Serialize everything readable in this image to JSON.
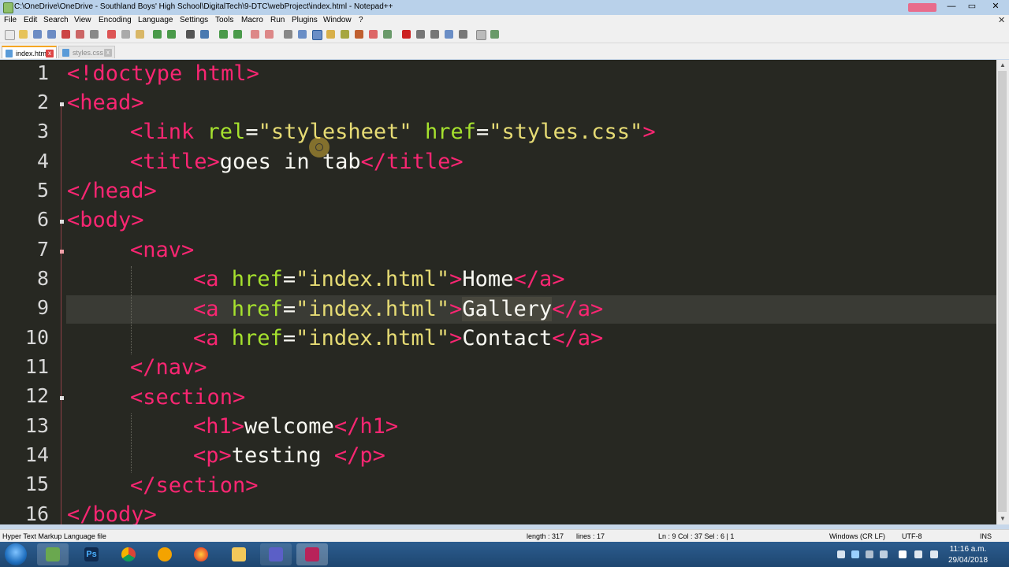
{
  "window": {
    "title": "C:\\OneDrive\\OneDrive - Southland Boys' High School\\DigitalTech\\9-DTC\\webProject\\index.html - Notepad++",
    "minimize": "—",
    "maximize": "▭",
    "close": "✕"
  },
  "menu": [
    "File",
    "Edit",
    "Search",
    "View",
    "Encoding",
    "Language",
    "Settings",
    "Tools",
    "Macro",
    "Run",
    "Plugins",
    "Window",
    "?"
  ],
  "menu_close": "✕",
  "tabs": [
    {
      "label": "index.html",
      "active": true
    },
    {
      "label": "styles.css",
      "active": false
    }
  ],
  "tab_close": "x",
  "line_numbers": [
    "1",
    "2",
    "3",
    "4",
    "5",
    "6",
    "7",
    "8",
    "9",
    "10",
    "11",
    "12",
    "13",
    "14",
    "15",
    "16"
  ],
  "code": {
    "l1_a": "<!doctype html>",
    "l2_a": "<head>",
    "l3_a": "<link ",
    "l3_b": "rel",
    "l3_c": "=",
    "l3_d": "\"stylesheet\"",
    "l3_e": " ",
    "l3_f": "href",
    "l3_g": "=",
    "l3_h": "\"styles.css\"",
    "l3_i": ">",
    "l4_a": "<title>",
    "l4_b": "goes in tab",
    "l4_c": "</title>",
    "l5_a": "</head>",
    "l6_a": "<body>",
    "l7_a": "<nav>",
    "l8_a": "<a ",
    "l8_b": "href",
    "l8_c": "=",
    "l8_d": "\"index.html\"",
    "l8_e": ">",
    "l8_f": "Home",
    "l8_g": "</a>",
    "l9_a": "<a ",
    "l9_b": "href",
    "l9_c": "=",
    "l9_d": "\"index.html\"",
    "l9_e": ">",
    "l9_f": "Gallery",
    "l9_g": "</a>",
    "l10_a": "<a ",
    "l10_b": "href",
    "l10_c": "=",
    "l10_d": "\"index.html\"",
    "l10_e": ">",
    "l10_f": "Contact",
    "l10_g": "</a>",
    "l11_a": "</nav>",
    "l12_a": "<section>",
    "l13_a": "<h1>",
    "l13_b": "welcome",
    "l13_c": "</h1>",
    "l14_a": "<p>",
    "l14_b": "testing ",
    "l14_c": "</p>",
    "l15_a": "</section>",
    "l16_a": "</body>"
  },
  "status": {
    "file_type": "Hyper Text Markup Language file",
    "length": "length : 317",
    "lines": "lines : 17",
    "position": "Ln : 9    Col : 37    Sel : 6 | 1",
    "eol": "Windows (CR LF)",
    "encoding": "UTF-8",
    "mode": "INS"
  },
  "taskbar": {
    "time": "11:16 a.m.",
    "date": "29/04/2018",
    "apps": [
      "Notepad",
      "Ps",
      "Chrome",
      "Chrome Canary",
      "Firefox",
      "File Explorer",
      "Teams",
      "Screen Recorder"
    ]
  },
  "colors": {
    "editor_bg": "#272822",
    "tag": "#f92672",
    "attribute": "#a6e22e",
    "string": "#e6db74",
    "text": "#f8f8f2"
  }
}
